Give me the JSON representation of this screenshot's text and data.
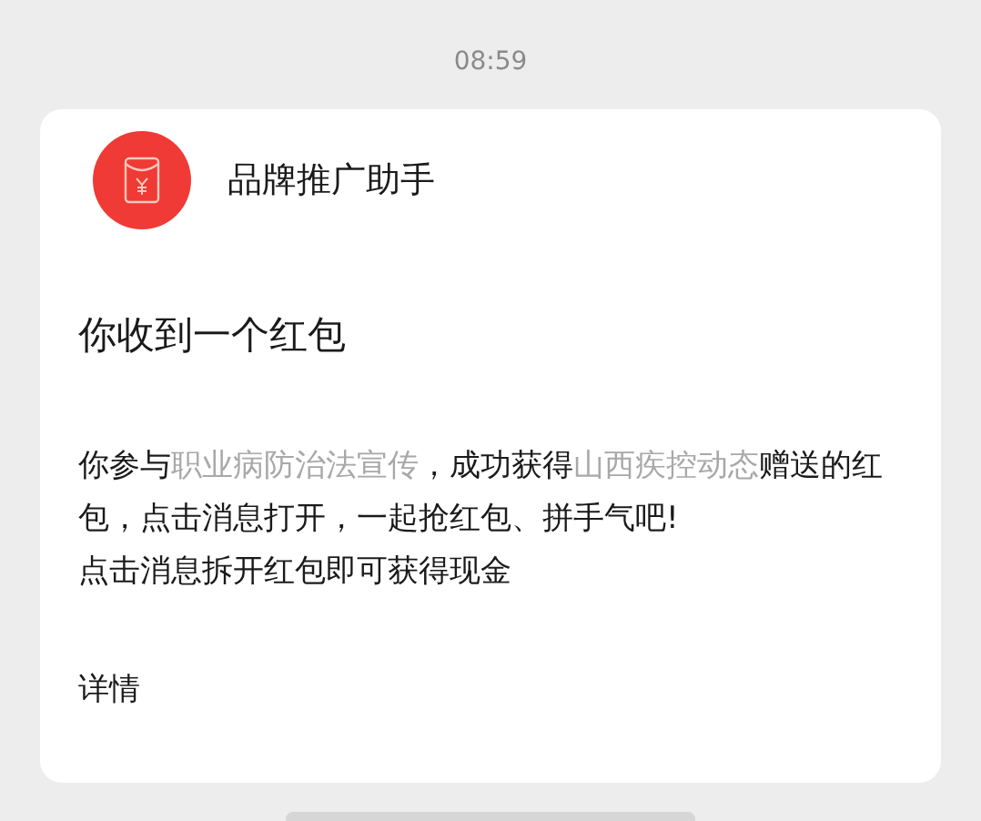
{
  "time": "08:59",
  "card": {
    "sender": "品牌推广助手",
    "title": "你收到一个红包",
    "message": [
      {
        "kind": "text",
        "text": "你参与"
      },
      {
        "kind": "link",
        "text": "职业病防治法宣传"
      },
      {
        "kind": "text",
        "text": "，成功获得"
      },
      {
        "kind": "link",
        "text": "山西疾控动态"
      },
      {
        "kind": "text",
        "text": "赠送的红包，点击消息打开，一起抢红包、拼手气吧!"
      }
    ],
    "note": "点击消息拆开红包即可获得现金",
    "details": "详情"
  }
}
